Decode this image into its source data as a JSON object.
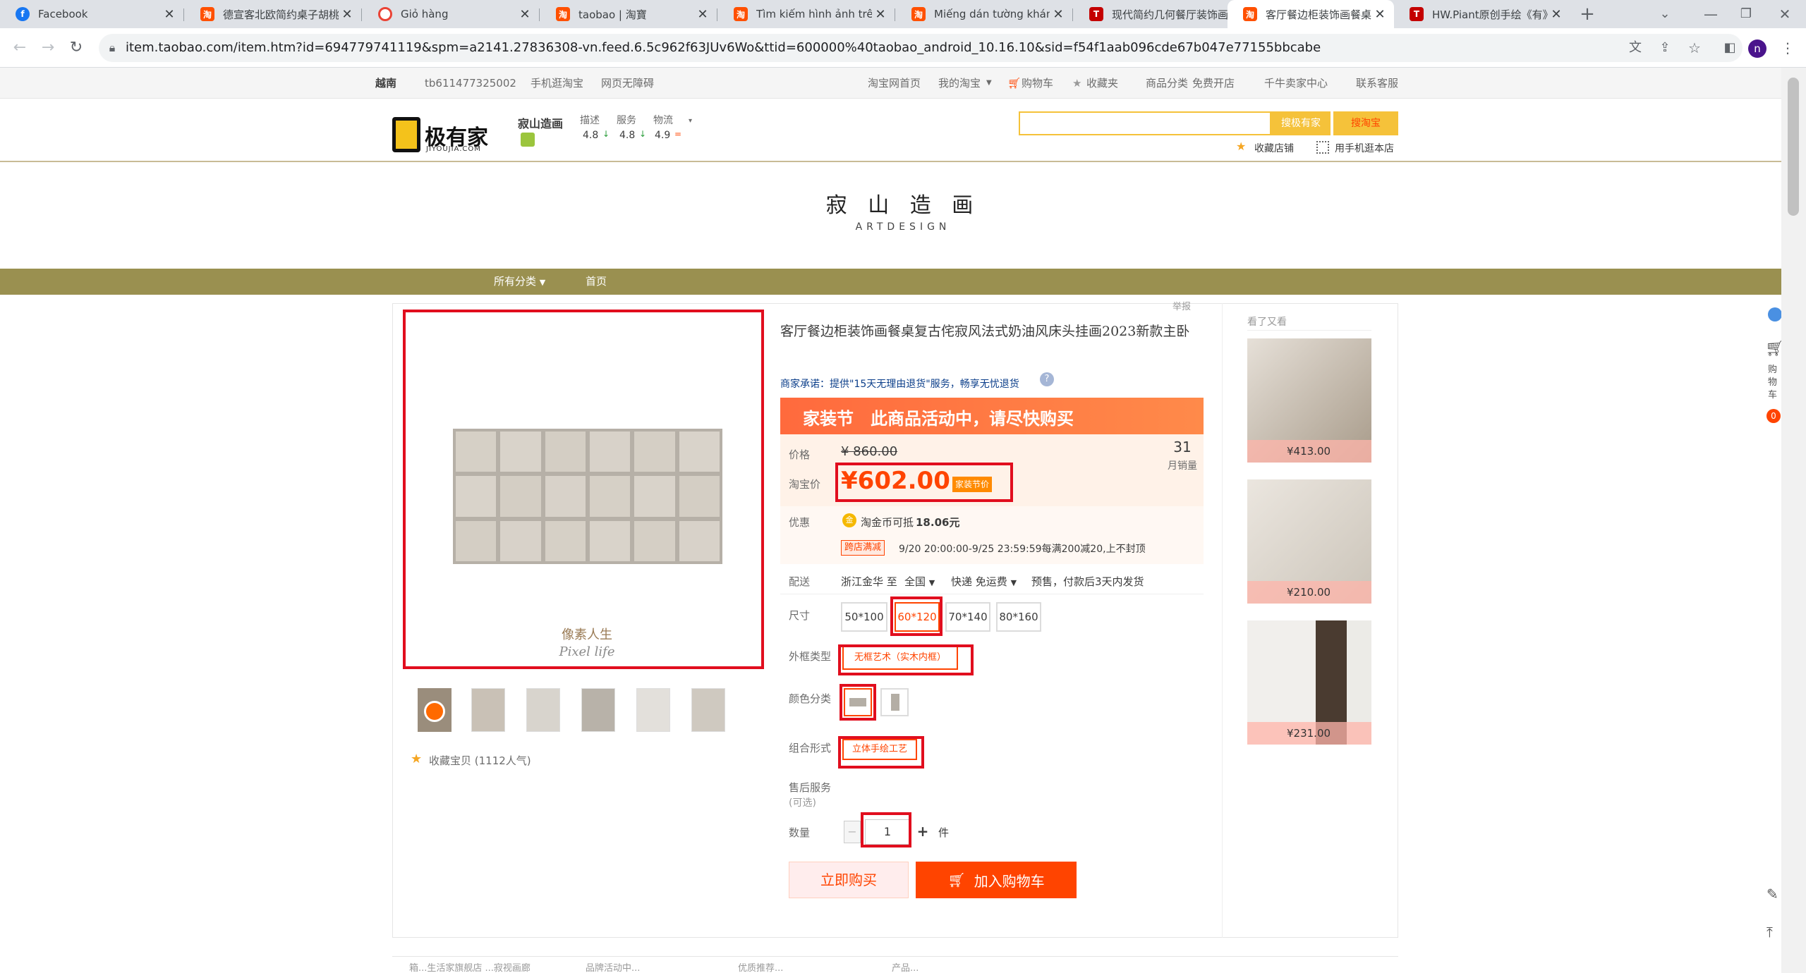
{
  "browser": {
    "tabs": [
      {
        "title": "Facebook",
        "icon": "facebook-icon",
        "color": "#1877f2"
      },
      {
        "title": "德宣客北欧简约桌子胡桃",
        "icon": "taobao-icon",
        "color": "#ff5000"
      },
      {
        "title": "Giỏ hàng",
        "icon": "cart-icon",
        "color": "#ea4335"
      },
      {
        "title": "taobao | 淘寶",
        "icon": "taobao-icon",
        "color": "#ff5000"
      },
      {
        "title": "Tìm kiếm hình ảnh trên t",
        "icon": "taobao-icon",
        "color": "#ff5000"
      },
      {
        "title": "Miếng dán tường khám t",
        "icon": "taobao-icon",
        "color": "#ff5000"
      },
      {
        "title": "现代简约几何餐厅装饰画",
        "icon": "tmall-icon",
        "color": "#c40000"
      },
      {
        "title": "客厅餐边柜装饰画餐桌复",
        "icon": "taobao-icon",
        "color": "#ff5000"
      },
      {
        "title": "HW.Piant原创手绘《有》",
        "icon": "tmall-icon",
        "color": "#c40000"
      }
    ],
    "url": "item.taobao.com/item.htm?id=694779741119&spm=a2141.27836308-vn.feed.6.5c962f63JUv6Wo&ttid=600000%40taobao_android_10.16.10&sid=f54f1aab096cde67b047e77155bbcabe",
    "profile_letter": "n"
  },
  "topnav": {
    "region": "越南",
    "user": "tb611477325002",
    "mobile": "手机逛淘宝",
    "accessible": "网页无障碍",
    "home": "淘宝网首页",
    "my_taobao": "我的淘宝",
    "cart": "购物车",
    "favorites": "收藏夹",
    "categories": "商品分类",
    "open_shop": "免费开店",
    "seller": "千牛卖家中心",
    "service": "联系客服"
  },
  "shop": {
    "logo_text": "极有家",
    "logo_sub": "JIYOUJIA.COM",
    "name": "寂山造画",
    "desc_label": "描述",
    "desc_score": "4.8",
    "svc_label": "服务",
    "svc_score": "4.8",
    "logi_label": "物流",
    "logi_score": "4.9",
    "search_all": "搜极有家",
    "search_taobao": "搜淘宝",
    "fav_shop": "收藏店铺",
    "mobile_shop": "用手机逛本店"
  },
  "banner": {
    "title": "寂 山 造 画",
    "subtitle": "ARTDESIGN"
  },
  "catbar": {
    "all": "所有分类",
    "home": "首页"
  },
  "product": {
    "report": "举报",
    "title": "客厅餐边柜装饰画餐桌复古侘寂风法式奶油风床头挂画2023新款主卧",
    "promise": "商家承诺：提供\"15天无理由退货\"服务，畅享无忧退货",
    "promo_banner": "家装节　此商品活动中，请尽快购买",
    "price_label": "价格",
    "orig_price": "¥ 860.00",
    "taobao_price_label": "淘宝价",
    "price": "¥602.00",
    "price_tag": "家装节价",
    "sales_count": "31",
    "sales_label": "月销量",
    "discount_label": "优惠",
    "coin_text": "淘金币可抵",
    "coin_amount": "18.06元",
    "cross_shop_tag": "跨店满减",
    "cross_shop_text": "9/20 20:00:00-9/25 23:59:59每满200减20,上不封顶",
    "delivery_label": "配送",
    "delivery_from": "浙江金华 至",
    "delivery_to": "全国",
    "delivery_fee": "快递 免运费",
    "delivery_note": "预售，付款后3天内发货",
    "size_label": "尺寸",
    "sizes": [
      "50*100",
      "60*120",
      "70*140",
      "80*160"
    ],
    "frame_label": "外框类型",
    "frame_value": "无框艺术（实木内框）",
    "color_label": "颜色分类",
    "combo_label": "组合形式",
    "combo_value": "立体手绘工艺",
    "after_sale_label": "售后服务",
    "after_sale_sub": "(可选)",
    "qty_label": "数量",
    "qty": "1",
    "qty_unit": "件",
    "buy_now": "立即购买",
    "add_cart": "加入购物车",
    "image_caption": "像素人生",
    "image_caption_en": "Pixel life",
    "favorite_item": "收藏宝贝 (1112人气)"
  },
  "also_viewed": {
    "title": "看了又看",
    "items": [
      {
        "price": "¥413.00"
      },
      {
        "price": "¥210.00"
      },
      {
        "price": "¥231.00"
      }
    ]
  },
  "sidebar": {
    "cart_label": "购物车",
    "cart_count": "0"
  },
  "bottom_tabs": [
    "箱...生活家旗舰店 ...寂视画廊",
    "品牌活动中...",
    "优质推荐...",
    "产品..."
  ]
}
